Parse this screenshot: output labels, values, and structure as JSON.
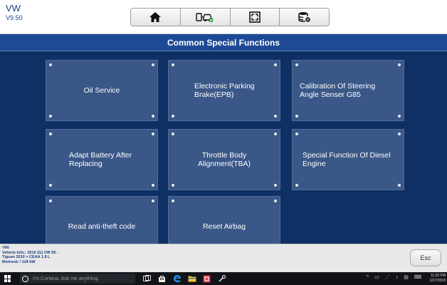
{
  "header": {
    "brand": "VW",
    "version": "V9.50",
    "toolbar": [
      {
        "icon": "home-icon"
      },
      {
        "icon": "vehicle-swap-icon"
      },
      {
        "icon": "fullscreen-icon"
      },
      {
        "icon": "database-settings-icon"
      }
    ]
  },
  "title": "Common Special Functions",
  "functions": [
    {
      "label": "Oil Service",
      "align": "center"
    },
    {
      "label": "Electronic Parking Brake(EPB)",
      "align": "left"
    },
    {
      "label": "Calibration Of Steering Angle Senser G85",
      "align": "left"
    },
    {
      "label": "Adapt Battery After Replacing",
      "align": "left"
    },
    {
      "label": "Throttle Body Alignment(TBA)",
      "align": "center"
    },
    {
      "label": "Special Function Of Diesel Engine",
      "align": "left"
    },
    {
      "label": "Read anti-theft code",
      "align": "center"
    },
    {
      "label": "Reset Airbag",
      "align": "center"
    }
  ],
  "footer": {
    "vin_label": "VIN:",
    "vehicle_info": "Vehicle Info.: 2016 (G) VW 59 -",
    "model": "Tiguan 2010 > CEAA 1.8 L",
    "engine": "Motronic / 118 kW",
    "esc_label": "Esc"
  },
  "taskbar": {
    "search_placeholder": "I'm Cortana. Ask me anything.",
    "time": "11:20 PM",
    "date": "2/27/2018"
  },
  "colors": {
    "accent": "#1e4a95",
    "main_bg": "#0f3064",
    "tile_bg": "#3a5787"
  }
}
